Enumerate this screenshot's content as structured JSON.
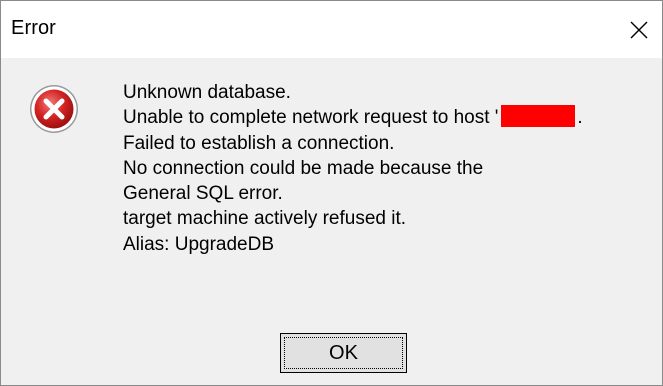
{
  "window": {
    "title": "Error",
    "close_icon": "close-icon"
  },
  "dialog": {
    "icon": "error-icon",
    "messages": {
      "line1": "Unknown database.",
      "line2_prefix": "Unable to complete network request to host '",
      "line2_suffix": ".",
      "line3": "Failed to establish a connection.",
      "line4": "No connection could be made because the",
      "line5": "General SQL error.",
      "line6": "target machine actively refused it.",
      "line7": "Alias: UpgradeDB"
    },
    "redaction_color": "#ff0000",
    "ok_label": "OK"
  }
}
